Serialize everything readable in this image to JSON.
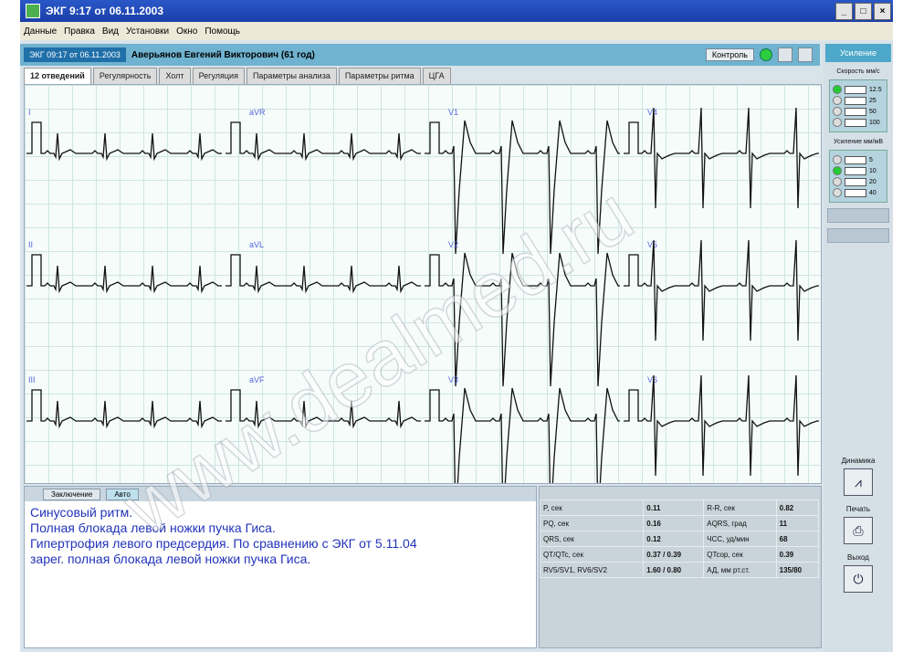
{
  "window": {
    "title": "ЭКГ 9:17 от 06.11.2003"
  },
  "titlebar_buttons": [
    "_",
    "□",
    "×"
  ],
  "menu": [
    "Данные",
    "Правка",
    "Вид",
    "Установки",
    "Окно",
    "Помощь"
  ],
  "patient": {
    "id": "ЭКГ 09:17 от 06.11.2003",
    "name": "Аверьянов Евгений Викторович (61 год)",
    "button_label": "Контроль"
  },
  "tabs": [
    "12 отведений",
    "Регулярность",
    "Холт",
    "Регуляция",
    "Параметры анализа",
    "Параметры ритма",
    "ЦГА"
  ],
  "leads": [
    "I",
    "aVR",
    "V1",
    "V4",
    "II",
    "aVL",
    "V2",
    "V5",
    "III",
    "aVF",
    "V3",
    "V6"
  ],
  "subtabs": {
    "left": "Заключение",
    "right": "Авто"
  },
  "conclusion": [
    "Синусовый ритм.",
    "Полная блокада левой ножки пучка Гиса.",
    "Гипертрофия левого предсердия. По сравнению с ЭКГ от 5.11.04",
    "зарег. полная блокада левой ножки пучка Гиса."
  ],
  "measurements": [
    [
      "P, сек",
      "0.11",
      "R-R, сек",
      "0.82"
    ],
    [
      "PQ, сек",
      "0.16",
      "AQRS, град",
      "11"
    ],
    [
      "QRS, сек",
      "0.12",
      "ЧСС, уд/мин",
      "68"
    ],
    [
      "QT/QTc, сек",
      "0.37 / 0.39",
      "QTcор, сек",
      "0.39"
    ],
    [
      "RV5/SV1, RV6/SV2",
      "1.60 / 0.80",
      "АД, мм рт.ст.",
      "135/80"
    ]
  ],
  "sidebar": {
    "header": "Усиление",
    "speed_label": "Скорость мм/с",
    "speed_options": [
      "12.5",
      "25",
      "50",
      "100"
    ],
    "amp_label": "Усиление мм/мВ",
    "amp_options": [
      "5",
      "10",
      "20",
      "40"
    ],
    "dynamics_label": "Динамика",
    "print_label": "Печать",
    "exit_label": "Выход"
  },
  "watermark": "www.dealmed.ru",
  "colors": {
    "accent": "#4ea8c9",
    "conclusion_text": "#2233bb",
    "grid": "#cfe6e1",
    "trace": "#111111"
  }
}
